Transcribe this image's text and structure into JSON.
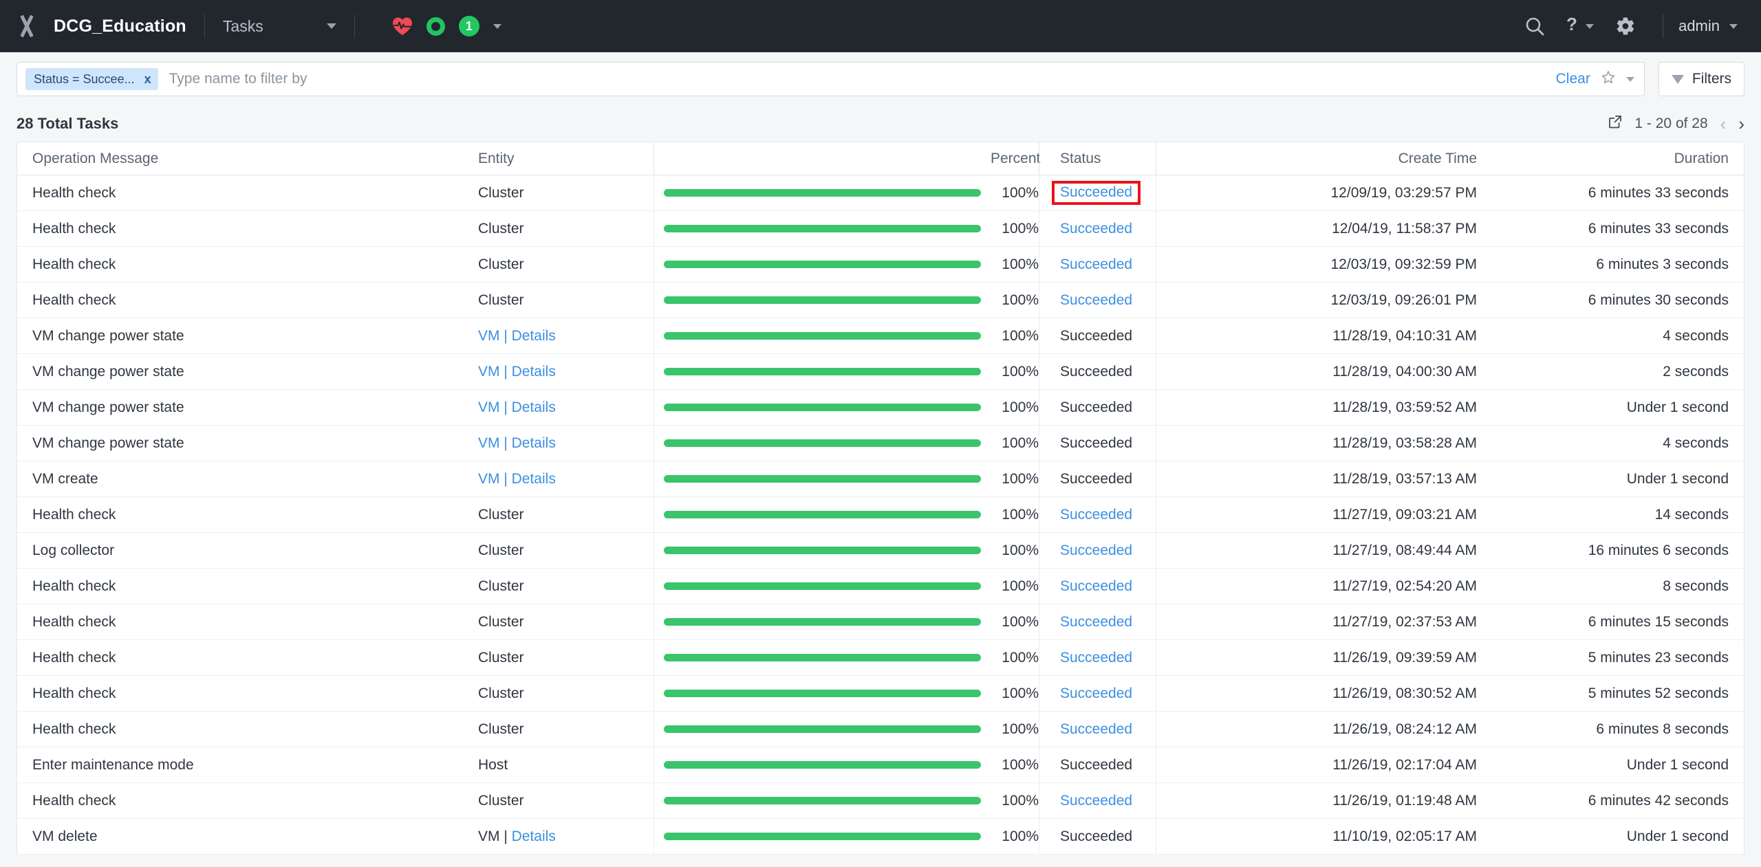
{
  "topnav": {
    "logo": "x-logo-icon",
    "app_name": "DCG_Education",
    "page_select": "Tasks",
    "health_badge_count": "1",
    "search_icon": "search-icon",
    "help_icon": "help-icon",
    "settings_icon": "gear-icon",
    "user_label": "admin"
  },
  "filterbar": {
    "chip_label": "Status = Succee...",
    "chip_remove": "x",
    "placeholder": "Type name to filter by",
    "clear_label": "Clear",
    "star_icon": "star-icon",
    "filters_label": "Filters"
  },
  "content": {
    "total_label": "28 Total Tasks",
    "export_icon": "export-icon",
    "page_range": "1 - 20 of 28",
    "prev_icon": "chevron-left-icon",
    "next_icon": "chevron-right-icon"
  },
  "table": {
    "columns": {
      "operation": "Operation Message",
      "entity": "Entity",
      "percent": "Percent",
      "status": "Status",
      "create_time": "Create Time",
      "duration": "Duration"
    },
    "rows": [
      {
        "operation": "Health check",
        "entity": "Cluster",
        "entity_link": false,
        "details": false,
        "percent": "100%",
        "progress": 100,
        "status": "Succeeded",
        "status_link": true,
        "highlighted": true,
        "create_time": "12/09/19, 03:29:57 PM",
        "duration": "6 minutes 33 seconds"
      },
      {
        "operation": "Health check",
        "entity": "Cluster",
        "entity_link": false,
        "details": false,
        "percent": "100%",
        "progress": 100,
        "status": "Succeeded",
        "status_link": true,
        "highlighted": false,
        "create_time": "12/04/19, 11:58:37 PM",
        "duration": "6 minutes 33 seconds"
      },
      {
        "operation": "Health check",
        "entity": "Cluster",
        "entity_link": false,
        "details": false,
        "percent": "100%",
        "progress": 100,
        "status": "Succeeded",
        "status_link": true,
        "highlighted": false,
        "create_time": "12/03/19, 09:32:59 PM",
        "duration": "6 minutes 3 seconds"
      },
      {
        "operation": "Health check",
        "entity": "Cluster",
        "entity_link": false,
        "details": false,
        "percent": "100%",
        "progress": 100,
        "status": "Succeeded",
        "status_link": true,
        "highlighted": false,
        "create_time": "12/03/19, 09:26:01 PM",
        "duration": "6 minutes 30 seconds"
      },
      {
        "operation": "VM change power state",
        "entity": "VM",
        "entity_link": true,
        "details": true,
        "details_label": "Details",
        "percent": "100%",
        "progress": 100,
        "status": "Succeeded",
        "status_link": false,
        "highlighted": false,
        "create_time": "11/28/19, 04:10:31 AM",
        "duration": "4 seconds"
      },
      {
        "operation": "VM change power state",
        "entity": "VM",
        "entity_link": true,
        "details": true,
        "details_label": "Details",
        "percent": "100%",
        "progress": 100,
        "status": "Succeeded",
        "status_link": false,
        "highlighted": false,
        "create_time": "11/28/19, 04:00:30 AM",
        "duration": "2 seconds"
      },
      {
        "operation": "VM change power state",
        "entity": "VM",
        "entity_link": true,
        "details": true,
        "details_label": "Details",
        "percent": "100%",
        "progress": 100,
        "status": "Succeeded",
        "status_link": false,
        "highlighted": false,
        "create_time": "11/28/19, 03:59:52 AM",
        "duration": "Under 1 second"
      },
      {
        "operation": "VM change power state",
        "entity": "VM",
        "entity_link": true,
        "details": true,
        "details_label": "Details",
        "percent": "100%",
        "progress": 100,
        "status": "Succeeded",
        "status_link": false,
        "highlighted": false,
        "create_time": "11/28/19, 03:58:28 AM",
        "duration": "4 seconds"
      },
      {
        "operation": "VM create",
        "entity": "VM",
        "entity_link": true,
        "details": true,
        "details_label": "Details",
        "percent": "100%",
        "progress": 100,
        "status": "Succeeded",
        "status_link": false,
        "highlighted": false,
        "create_time": "11/28/19, 03:57:13 AM",
        "duration": "Under 1 second"
      },
      {
        "operation": "Health check",
        "entity": "Cluster",
        "entity_link": false,
        "details": false,
        "percent": "100%",
        "progress": 100,
        "status": "Succeeded",
        "status_link": true,
        "highlighted": false,
        "create_time": "11/27/19, 09:03:21 AM",
        "duration": "14 seconds"
      },
      {
        "operation": "Log collector",
        "entity": "Cluster",
        "entity_link": false,
        "details": false,
        "percent": "100%",
        "progress": 100,
        "status": "Succeeded",
        "status_link": true,
        "highlighted": false,
        "create_time": "11/27/19, 08:49:44 AM",
        "duration": "16 minutes 6 seconds"
      },
      {
        "operation": "Health check",
        "entity": "Cluster",
        "entity_link": false,
        "details": false,
        "percent": "100%",
        "progress": 100,
        "status": "Succeeded",
        "status_link": true,
        "highlighted": false,
        "create_time": "11/27/19, 02:54:20 AM",
        "duration": "8 seconds"
      },
      {
        "operation": "Health check",
        "entity": "Cluster",
        "entity_link": false,
        "details": false,
        "percent": "100%",
        "progress": 100,
        "status": "Succeeded",
        "status_link": true,
        "highlighted": false,
        "create_time": "11/27/19, 02:37:53 AM",
        "duration": "6 minutes 15 seconds"
      },
      {
        "operation": "Health check",
        "entity": "Cluster",
        "entity_link": false,
        "details": false,
        "percent": "100%",
        "progress": 100,
        "status": "Succeeded",
        "status_link": true,
        "highlighted": false,
        "create_time": "11/26/19, 09:39:59 AM",
        "duration": "5 minutes 23 seconds"
      },
      {
        "operation": "Health check",
        "entity": "Cluster",
        "entity_link": false,
        "details": false,
        "percent": "100%",
        "progress": 100,
        "status": "Succeeded",
        "status_link": true,
        "highlighted": false,
        "create_time": "11/26/19, 08:30:52 AM",
        "duration": "5 minutes 52 seconds"
      },
      {
        "operation": "Health check",
        "entity": "Cluster",
        "entity_link": false,
        "details": false,
        "percent": "100%",
        "progress": 100,
        "status": "Succeeded",
        "status_link": true,
        "highlighted": false,
        "create_time": "11/26/19, 08:24:12 AM",
        "duration": "6 minutes 8 seconds"
      },
      {
        "operation": "Enter maintenance mode",
        "entity": "Host",
        "entity_link": false,
        "details": false,
        "percent": "100%",
        "progress": 100,
        "status": "Succeeded",
        "status_link": false,
        "highlighted": false,
        "create_time": "11/26/19, 02:17:04 AM",
        "duration": "Under 1 second"
      },
      {
        "operation": "Health check",
        "entity": "Cluster",
        "entity_link": false,
        "details": false,
        "percent": "100%",
        "progress": 100,
        "status": "Succeeded",
        "status_link": true,
        "highlighted": false,
        "create_time": "11/26/19, 01:19:48 AM",
        "duration": "6 minutes 42 seconds"
      },
      {
        "operation": "VM delete",
        "entity": "VM",
        "entity_link": false,
        "details": true,
        "details_label": "Details",
        "percent": "100%",
        "progress": 100,
        "status": "Succeeded",
        "status_link": false,
        "highlighted": false,
        "create_time": "11/10/19, 02:05:17 AM",
        "duration": "Under 1 second"
      }
    ]
  },
  "colors": {
    "topbar_bg": "#22272e",
    "accent_link": "#3b8fe0",
    "progress_green": "#3ac46c",
    "highlight_red": "#e8131a",
    "badge_green": "#21c75f",
    "heart_red": "#ef4a53"
  }
}
